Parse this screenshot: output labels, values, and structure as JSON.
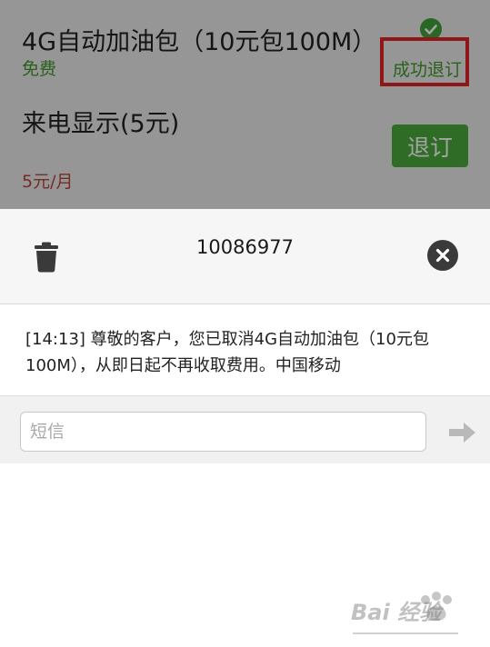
{
  "packages": [
    {
      "title": "4G自动加油包（10元包100M）",
      "price": "免费",
      "status": "成功退订"
    },
    {
      "title": "来电显示(5元)",
      "price": "5元/月",
      "action_label": "退订"
    }
  ],
  "sms_panel": {
    "sender": "10086977",
    "message": "[14:13] 尊敬的客户，您已取消4G自动加油包（10元包100M），从即日起不再收取费用。中国移动",
    "input_placeholder": "短信"
  },
  "watermark": "Bai 经验",
  "colors": {
    "accent_green": "#4aaa3c",
    "success_green": "#3f9a2a",
    "highlight_red": "#e02424",
    "price_red": "#b8463c"
  },
  "icons": [
    "check-icon",
    "trash-icon",
    "close-icon",
    "send-icon"
  ]
}
